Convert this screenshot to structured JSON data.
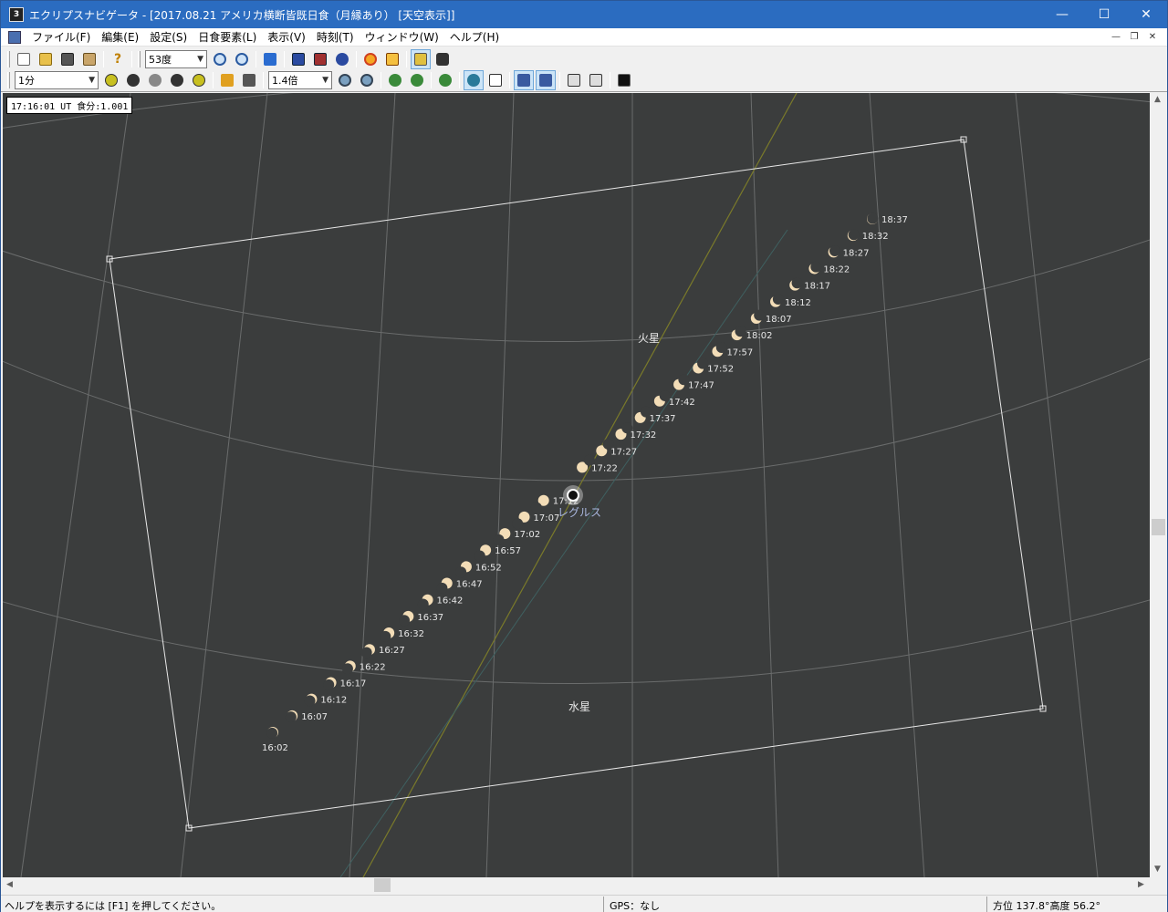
{
  "window": {
    "title": "エクリプスナビゲータ - [2017.08.21 アメリカ横断皆既日食（月縁あり） [天空表示]]",
    "app_icon_text": "3",
    "controls": [
      "—",
      "☐",
      "✕"
    ]
  },
  "menu": {
    "items": [
      "ファイル(F)",
      "編集(E)",
      "設定(S)",
      "日食要素(L)",
      "表示(V)",
      "時刻(T)",
      "ウィンドウ(W)",
      "ヘルプ(H)"
    ],
    "mdi_controls": [
      "—",
      "❐",
      "✕"
    ]
  },
  "toolbar1": {
    "fov_value": "53度"
  },
  "toolbar2": {
    "step_value": "1分",
    "zoom_value": "1.4倍"
  },
  "sky": {
    "info": "17:16:01 UT 食分:1.001",
    "planet_labels": [
      "火星",
      "水星"
    ],
    "star_label": "レグルス",
    "colors": {
      "background": "#3b3d3d",
      "sun": "#f3ddb7",
      "grid": "#8a8c8c",
      "ecliptic": "#7a7a2a"
    },
    "time_series": [
      "16:02",
      "16:07",
      "16:12",
      "16:17",
      "16:22",
      "16:27",
      "16:32",
      "16:37",
      "16:42",
      "16:47",
      "16:52",
      "16:57",
      "17:02",
      "17:07",
      "17:12",
      "17:22",
      "17:27",
      "17:32",
      "17:37",
      "17:42",
      "17:47",
      "17:52",
      "17:57",
      "18:02",
      "18:07",
      "18:12",
      "18:17",
      "18:22",
      "18:27",
      "18:32",
      "18:37"
    ]
  },
  "status": {
    "help": "ヘルプを表示するには [F1] を押してください。",
    "gps": "GPS：なし",
    "position": "方位 137.8°高度  56.2°"
  }
}
